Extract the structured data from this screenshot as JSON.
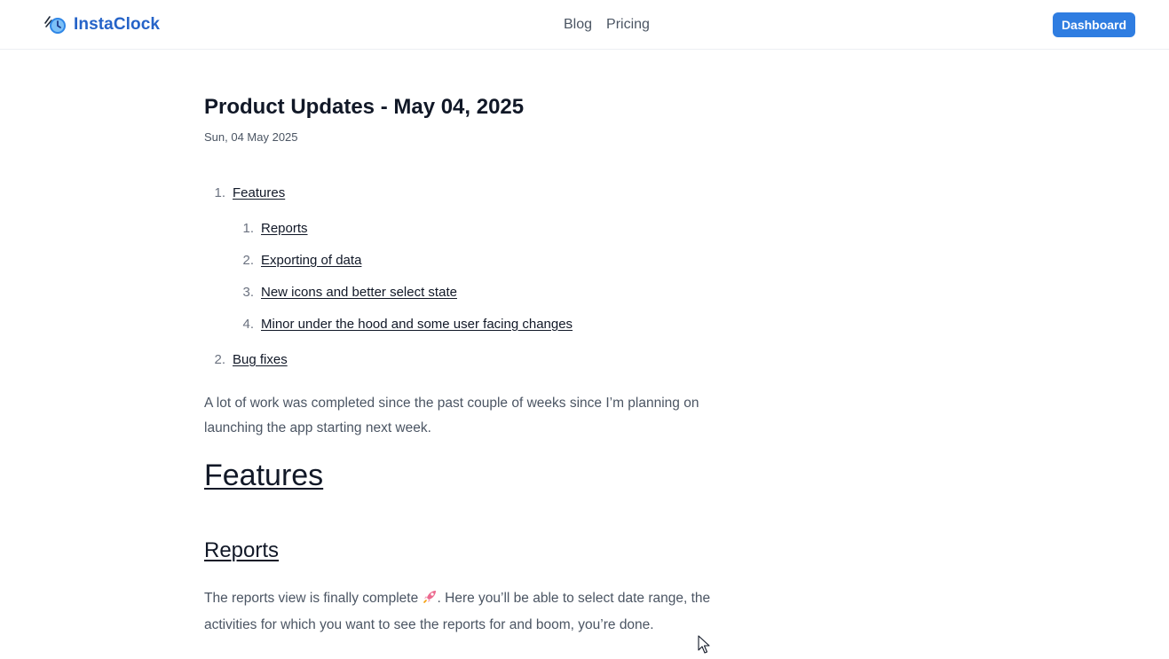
{
  "header": {
    "brand": "InstaClock",
    "nav": [
      "Blog",
      "Pricing"
    ],
    "dashboard_label": "Dashboard"
  },
  "article": {
    "title": "Product Updates - May 04, 2025",
    "date": "Sun, 04 May 2025",
    "toc": [
      {
        "number": "1.",
        "label": "Features",
        "children": [
          {
            "number": "1.",
            "label": "Reports"
          },
          {
            "number": "2.",
            "label": "Exporting of data"
          },
          {
            "number": "3.",
            "label": "New icons and better select state"
          },
          {
            "number": "4.",
            "label": "Minor under the hood and some user facing changes"
          }
        ]
      },
      {
        "number": "2.",
        "label": "Bug fixes"
      }
    ],
    "intro": "A lot of work was completed since the past couple of weeks since I’m planning on launching the app starting next week.",
    "features_heading": "Features",
    "reports_heading": "Reports",
    "reports_text_before": "The reports view is finally complete ",
    "reports_emoji_icon": "rocket-icon",
    "reports_text_after": ". Here you’ll be able to select date range, the activities for which you want to see the reports for and boom, you’re done."
  },
  "colors": {
    "brand": "#2563c8",
    "button": "#2f7de1",
    "text": "#111827",
    "muted": "#4b5563"
  }
}
